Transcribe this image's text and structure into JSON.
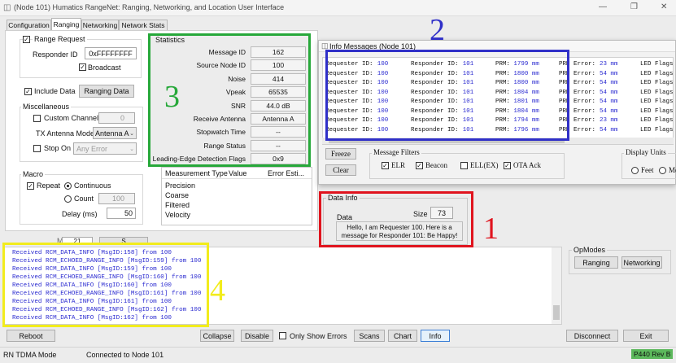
{
  "window": {
    "title": "(Node 101) Humatics RangeNet: Ranging, Networking, and Location User Interface",
    "controls": [
      "—",
      "❐",
      "✕"
    ]
  },
  "tabs": [
    "Configuration",
    "Ranging",
    "Networking",
    "Network Stats"
  ],
  "range_request": {
    "title": "Range Request",
    "responder_label": "Responder ID",
    "responder_value": "0xFFFFFFFF",
    "broadcast_label": "Broadcast"
  },
  "include_data": {
    "label": "Include Data",
    "button": "Ranging Data"
  },
  "misc": {
    "title": "Miscellaneous",
    "custom_channel_label": "Custom Channel",
    "custom_channel_value": "0",
    "tx_antenna_label": "TX Antenna Mode",
    "tx_antenna_value": "Antenna A",
    "stop_on_label": "Stop On",
    "stop_on_value": "Any Error"
  },
  "macro": {
    "title": "Macro",
    "repeat_label": "Repeat",
    "continuous_label": "Continuous",
    "count_label": "Count",
    "count_value": "100",
    "delay_label": "Delay (ms)",
    "delay_value": "50",
    "partial_left": "M",
    "partial_value": "21",
    "partial_button": "S"
  },
  "statistics": {
    "title": "Statistics",
    "rows": [
      {
        "label": "Message ID",
        "value": "162"
      },
      {
        "label": "Source Node ID",
        "value": "100"
      },
      {
        "label": "Noise",
        "value": "414"
      },
      {
        "label": "Vpeak",
        "value": "65535"
      },
      {
        "label": "SNR",
        "value": "44.0 dB"
      },
      {
        "label": "Receive Antenna",
        "value": "Antenna A"
      },
      {
        "label": "Stopwatch Time",
        "value": "--"
      },
      {
        "label": "Range Status",
        "value": "--"
      },
      {
        "label": "Leading-Edge Detection Flags",
        "value": "0x9"
      }
    ]
  },
  "measurement": {
    "headers": [
      "Measurement Type",
      "Value",
      "Error Esti..."
    ],
    "rows": [
      "Precision",
      "Coarse",
      "Filtered",
      "Velocity"
    ]
  },
  "info_messages": {
    "title": "Info Messages (Node 101)",
    "lines": [
      {
        "req": "100",
        "resp": "101",
        "prm": "1799 mm",
        "err": "23 mm"
      },
      {
        "req": "100",
        "resp": "101",
        "prm": "1800 mm",
        "err": "54 mm"
      },
      {
        "req": "100",
        "resp": "101",
        "prm": "1800 mm",
        "err": "54 mm"
      },
      {
        "req": "100",
        "resp": "101",
        "prm": "1804 mm",
        "err": "54 mm"
      },
      {
        "req": "100",
        "resp": "101",
        "prm": "1801 mm",
        "err": "54 mm"
      },
      {
        "req": "100",
        "resp": "101",
        "prm": "1804 mm",
        "err": "54 mm"
      },
      {
        "req": "100",
        "resp": "101",
        "prm": "1794 mm",
        "err": "23 mm"
      },
      {
        "req": "100",
        "resp": "101",
        "prm": "1796 mm",
        "err": "54 mm"
      }
    ],
    "labels": {
      "req": "Requester ID:",
      "resp": "Responder ID:",
      "prm": "PRM:",
      "err": "PRM Error:",
      "flags": "LED Flags"
    },
    "freeze_button": "Freeze",
    "clear_button": "Clear",
    "filters_title": "Message Filters",
    "filters": [
      "ELR",
      "Beacon",
      "ELL(EX)",
      "OTA Ack"
    ],
    "display_units_title": "Display Units",
    "units": [
      "Feet",
      "Met"
    ]
  },
  "data_info": {
    "title": "Data Info",
    "data_label": "Data",
    "size_label": "Size",
    "size_value": "73",
    "message_line1": "Hello, I am Requester 100. Here is a",
    "message_line2": "message for Responder 101: Be Happy!"
  },
  "log": {
    "lines": [
      "Received RCM_DATA_INFO [MsgID:158] from 100",
      "Received RCM_ECHOED_RANGE_INFO [MsgID:159] from 100",
      "Received RCM_DATA_INFO [MsgID:159] from 100",
      "Received RCM_ECHOED_RANGE_INFO [MsgID:160] from 100",
      "Received RCM_DATA_INFO [MsgID:160] from 100",
      "Received RCM_ECHOED_RANGE_INFO [MsgID:161] from 100",
      "Received RCM_DATA_INFO [MsgID:161] from 100",
      "Received RCM_ECHOED_RANGE_INFO [MsgID:162] from 100",
      "Received RCM_DATA_INFO [MsgID:162] from 100"
    ]
  },
  "opmodes": {
    "title": "OpModes",
    "ranging": "Ranging",
    "networking": "Networking"
  },
  "bottom": {
    "reboot": "Reboot",
    "collapse": "Collapse",
    "disable": "Disable",
    "only_errors": "Only Show Errors",
    "scans": "Scans",
    "chart": "Chart",
    "info": "Info",
    "disconnect": "Disconnect",
    "exit": "Exit"
  },
  "status": {
    "mode": "RN TDMA Mode",
    "connection": "Connected to Node 101",
    "badge": "P440 Rev B"
  },
  "annotations": [
    "1",
    "2",
    "3",
    "4"
  ],
  "colors": {
    "red": "#e0141e",
    "blue": "#3030c8",
    "green": "#27a83a",
    "yellow": "#f2ec1c",
    "badge": "#5cb85c",
    "log_text": "#2a2ad0"
  }
}
